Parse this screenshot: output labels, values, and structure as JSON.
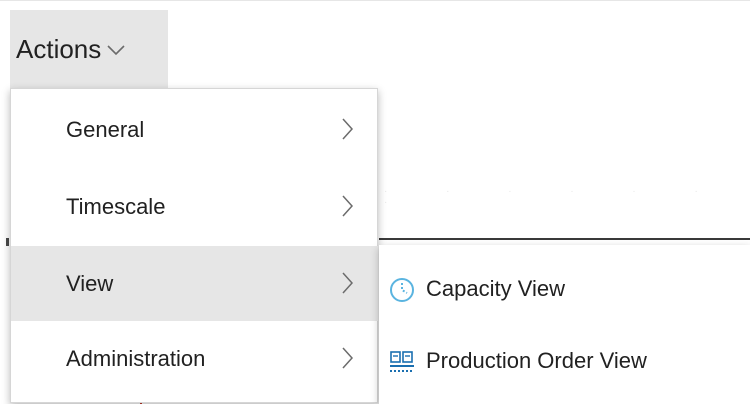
{
  "actions_button": {
    "label": "Actions",
    "icon": "chevron-down-icon"
  },
  "menu": {
    "items": [
      {
        "label": "General",
        "icon": "chevron-right-icon"
      },
      {
        "label": "Timescale",
        "icon": "chevron-right-icon"
      },
      {
        "label": "View",
        "icon": "chevron-right-icon",
        "active": true
      },
      {
        "label": "Administration",
        "icon": "chevron-right-icon"
      }
    ]
  },
  "submenu": {
    "items": [
      {
        "label": "Capacity View",
        "icon": "capacity-clock-icon"
      },
      {
        "label": "Production Order View",
        "icon": "production-order-icon"
      }
    ]
  },
  "colors": {
    "menu_hover_bg": "#e6e6e6",
    "text": "#212121",
    "chevron": "#6b6b6b",
    "capacity_icon": "#5ab4e0",
    "production_icon": "#1a6fb0"
  }
}
